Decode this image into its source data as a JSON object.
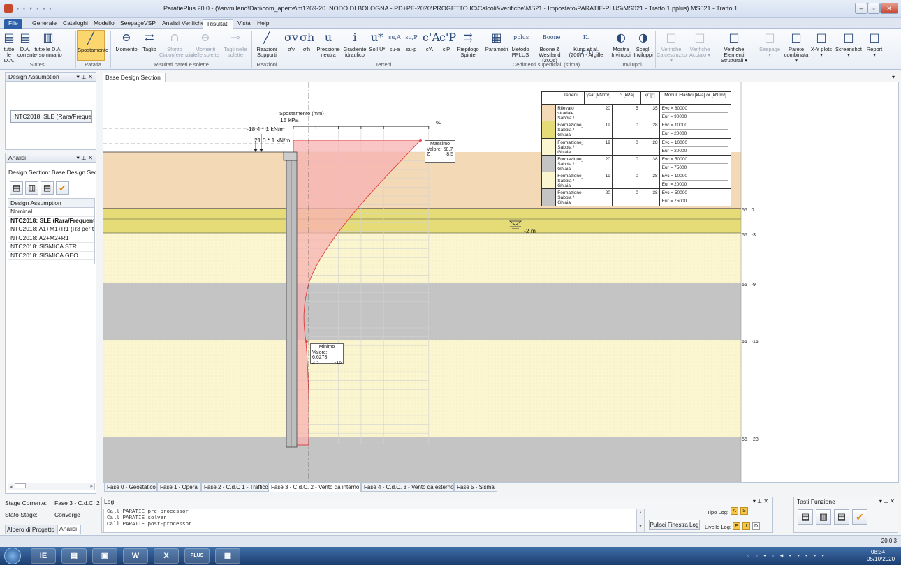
{
  "window": {
    "title": "ParatiePlus 20.0 - (\\\\srvmilano\\Dati\\com_aperte\\m1269-20. NODO DI BOLOGNA - PD+PE-2020\\PROGETTO IC\\Calcoli&verifiche\\MS21 - Impostato\\PARATIE-PLUS\\MS021 - Tratto 1.pplus) MS021 - Tratto 1"
  },
  "ribbon_tabs": [
    "File",
    "Generale",
    "Cataloghi",
    "Modello",
    "Seepage",
    "VSP",
    "Analisi",
    "Verifiche",
    "Risultati",
    "Vista",
    "Help"
  ],
  "ribbon": {
    "buttons": [
      {
        "label": "tutte le D.A.",
        "icon": "▤"
      },
      {
        "label": "D.A. corrente",
        "icon": "▤"
      },
      {
        "label": "tutte le D.A. + sommario",
        "icon": "▥"
      },
      {
        "label": "Spostamento",
        "icon": "╱"
      },
      {
        "label": "Momento",
        "icon": "⊖"
      },
      {
        "label": "Taglio",
        "icon": "⇄"
      },
      {
        "label": "Sforzo Circonferenziale",
        "icon": "∩"
      },
      {
        "label": "Momenti nelle solette",
        "icon": "⊖"
      },
      {
        "label": "Tagli nelle solette",
        "icon": "⊸"
      },
      {
        "label": "Reazioni Supporti",
        "icon": "╱"
      },
      {
        "label": "σ'v",
        "icon": "σv"
      },
      {
        "label": "σ'h",
        "icon": "σh"
      },
      {
        "label": "Pressione neutra",
        "icon": "u"
      },
      {
        "label": "Gradiente idraulico",
        "icon": "i"
      },
      {
        "label": "Soil U*",
        "icon": "u*"
      },
      {
        "label": "su-a",
        "icon": "su,A"
      },
      {
        "label": "su-p",
        "icon": "su,P"
      },
      {
        "label": "c'A",
        "icon": "c'A"
      },
      {
        "label": "c'P",
        "icon": "c'P"
      },
      {
        "label": "Riepilogo Spinte",
        "icon": "⇉"
      },
      {
        "label": "Parametri",
        "icon": "▦"
      },
      {
        "label": "Metodo PPLUS",
        "icon": "pplus"
      },
      {
        "label": "Boone & Westland (2006)",
        "icon": "Boone"
      },
      {
        "label": "Kung et al. (2007) - Argille",
        "icon": "K.(HH)"
      },
      {
        "label": "Mostra Inviluppi",
        "icon": "◐"
      },
      {
        "label": "Scegli Inviluppi",
        "icon": "◑"
      },
      {
        "label": "Verifiche Calcestruzzo ▾",
        "icon": "□"
      },
      {
        "label": "Verifiche Acciaio ▾",
        "icon": "□"
      },
      {
        "label": "Verifiche Elementi Strutturali ▾",
        "icon": "□"
      },
      {
        "label": "Seepage ▾",
        "icon": "□"
      },
      {
        "label": "Parete combinata ▾",
        "icon": "□"
      },
      {
        "label": "X-Y plots ▾",
        "icon": "□"
      },
      {
        "label": "Screenshot ▾",
        "icon": "□"
      },
      {
        "label": "Report ▾",
        "icon": "□"
      }
    ],
    "groups": [
      "Sintesi",
      "Paratia",
      "Risultati pareti e solette",
      "Reazioni",
      "Terreni",
      "Cedimenti superficiali (stima)",
      "Inviluppi"
    ]
  },
  "design_assumption_panel": {
    "title": "Design Assumption",
    "selected": "NTC2018: SLE (Rara/Freque ▾"
  },
  "analisi_panel": {
    "title": "Analisi",
    "design_section": "Design Section:  Base Design Sect",
    "list_header": "Design Assumption",
    "items": [
      "Nominal",
      "NTC2018: SLE (Rara/Frequente",
      "NTC2018: A1+M1+R1 (R3 per ti",
      "NTC2018: A2+M2+R1",
      "NTC2018: SISMICA STR",
      "NTC2018: SISMICA GEO"
    ]
  },
  "stage_info": {
    "corrente_label": "Stage Corrente:",
    "corrente_value": "Fase 3 - C.d.C. 2",
    "stato_label": "Stato Stage:",
    "stato_value": "Converge"
  },
  "bottom_tabs": [
    "Albero di Progetto",
    "Analisi"
  ],
  "document_tab": "Base Design Section ✕",
  "drawing": {
    "disp_title": "Spostamento (mm)",
    "disp_max_tick": "60",
    "loads": [
      "15 kPa",
      "-18.4 * 1 kN/m",
      "21.0 * 1 kN/m"
    ],
    "max_label": "Massimo",
    "max_value": "Valore: 58.7",
    "max_z": "Z :",
    "max_z_val": "8.5",
    "min_label": "Minimo",
    "min_value": "Valore: 6.6278",
    "min_z": "Z :",
    "min_z_val": "-16",
    "water": "-2 m",
    "elevations": [
      "55 , 0",
      "55 , -3",
      "55 , -9",
      "55 , -16",
      "55 , -28"
    ]
  },
  "soil_table": {
    "headers": [
      "Terreni",
      "γsat [kN/m³]",
      "c' [kPa]",
      "φ' [°]",
      "Moduli Elastici [kPa] or [kN/m³]"
    ],
    "rows": [
      {
        "name": "Rilevato stradale Sabbia / Ghiaia",
        "g": "20",
        "c": "5",
        "phi": "35",
        "evc": "Evc = 60000",
        "eur": "Eur = 90000",
        "color": "#f4d9b6"
      },
      {
        "name": "Formazione_A0 Sabbia / Ghiaia",
        "g": "19",
        "c": "0",
        "phi": "28",
        "evc": "Evc = 10000",
        "eur": "Eur = 20000",
        "color": "#e5dc77"
      },
      {
        "name": "Formazione_A1 Sabbia / Ghiaia",
        "g": "19",
        "c": "0",
        "phi": "28",
        "evc": "Evc = 10000",
        "eur": "Eur = 20000",
        "color": "#fbf6cf"
      },
      {
        "name": "Formazione_B Sabbia / Ghiaia",
        "g": "20",
        "c": "0",
        "phi": "38",
        "evc": "Evc = 50000",
        "eur": "Eur = 75000",
        "color": "#c4c4c4"
      },
      {
        "name": "Formazione_A1 Sabbia / Ghiaia",
        "g": "19",
        "c": "0",
        "phi": "28",
        "evc": "Evc = 10000",
        "eur": "Eur = 20000",
        "color": "#fbf6cf"
      },
      {
        "name": "Formazione_B Sabbia / Ghiaia",
        "g": "20",
        "c": "0",
        "phi": "38",
        "evc": "Evc = 50000",
        "eur": "Eur = 75000",
        "color": "#c4c4c4"
      }
    ]
  },
  "phase_tabs": [
    "Fase 0 - Geostatico",
    "Fase 1 - Opera",
    "Fase 2 - C.d.C 1 - Traffico",
    "Fase 3 - C.d.C. 2 - Vento da interno",
    "Fase 4 - C.d.C. 3 - Vento da esterno",
    "Fase 5 - Sisma"
  ],
  "log": {
    "title": "Log",
    "lines": [
      "Call PARATIE pre-processor",
      "Call PARATIE solver",
      "Call PARATIE post-processor"
    ],
    "clear_button": "Pulisci Finestra Log",
    "tipo_label": "Tipo Log:",
    "tipo_opts": [
      "A",
      "S"
    ],
    "livello_label": "Livello Log:",
    "livello_opts": [
      "E",
      "I",
      "D"
    ]
  },
  "tasti_panel": {
    "title": "Tasti Funzione"
  },
  "version": "20.0.3",
  "taskbar": {
    "apps": [
      "IE",
      "▤",
      "▣",
      "W",
      "X",
      "PLUS",
      "▦"
    ],
    "time": "08:34",
    "date": "05/10/2020"
  }
}
